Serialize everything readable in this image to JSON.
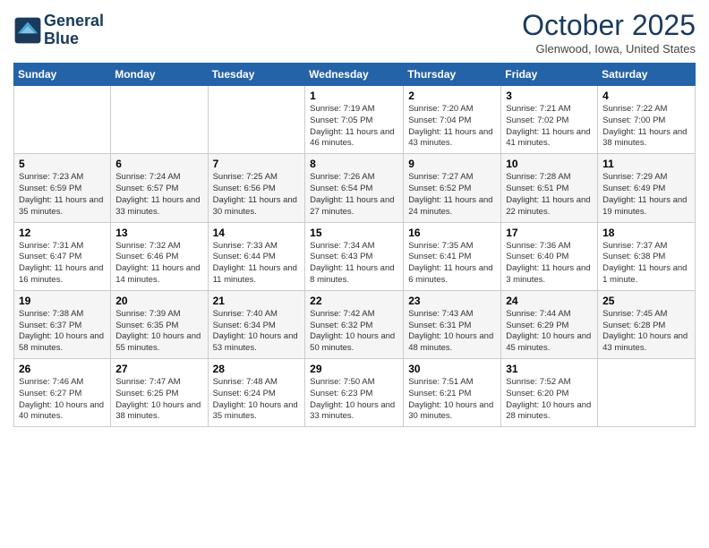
{
  "header": {
    "logo_line1": "General",
    "logo_line2": "Blue",
    "month": "October 2025",
    "location": "Glenwood, Iowa, United States"
  },
  "weekdays": [
    "Sunday",
    "Monday",
    "Tuesday",
    "Wednesday",
    "Thursday",
    "Friday",
    "Saturday"
  ],
  "weeks": [
    [
      {
        "day": "",
        "info": ""
      },
      {
        "day": "",
        "info": ""
      },
      {
        "day": "",
        "info": ""
      },
      {
        "day": "1",
        "info": "Sunrise: 7:19 AM\nSunset: 7:05 PM\nDaylight: 11 hours\nand 46 minutes."
      },
      {
        "day": "2",
        "info": "Sunrise: 7:20 AM\nSunset: 7:04 PM\nDaylight: 11 hours\nand 43 minutes."
      },
      {
        "day": "3",
        "info": "Sunrise: 7:21 AM\nSunset: 7:02 PM\nDaylight: 11 hours\nand 41 minutes."
      },
      {
        "day": "4",
        "info": "Sunrise: 7:22 AM\nSunset: 7:00 PM\nDaylight: 11 hours\nand 38 minutes."
      }
    ],
    [
      {
        "day": "5",
        "info": "Sunrise: 7:23 AM\nSunset: 6:59 PM\nDaylight: 11 hours\nand 35 minutes."
      },
      {
        "day": "6",
        "info": "Sunrise: 7:24 AM\nSunset: 6:57 PM\nDaylight: 11 hours\nand 33 minutes."
      },
      {
        "day": "7",
        "info": "Sunrise: 7:25 AM\nSunset: 6:56 PM\nDaylight: 11 hours\nand 30 minutes."
      },
      {
        "day": "8",
        "info": "Sunrise: 7:26 AM\nSunset: 6:54 PM\nDaylight: 11 hours\nand 27 minutes."
      },
      {
        "day": "9",
        "info": "Sunrise: 7:27 AM\nSunset: 6:52 PM\nDaylight: 11 hours\nand 24 minutes."
      },
      {
        "day": "10",
        "info": "Sunrise: 7:28 AM\nSunset: 6:51 PM\nDaylight: 11 hours\nand 22 minutes."
      },
      {
        "day": "11",
        "info": "Sunrise: 7:29 AM\nSunset: 6:49 PM\nDaylight: 11 hours\nand 19 minutes."
      }
    ],
    [
      {
        "day": "12",
        "info": "Sunrise: 7:31 AM\nSunset: 6:47 PM\nDaylight: 11 hours\nand 16 minutes."
      },
      {
        "day": "13",
        "info": "Sunrise: 7:32 AM\nSunset: 6:46 PM\nDaylight: 11 hours\nand 14 minutes."
      },
      {
        "day": "14",
        "info": "Sunrise: 7:33 AM\nSunset: 6:44 PM\nDaylight: 11 hours\nand 11 minutes."
      },
      {
        "day": "15",
        "info": "Sunrise: 7:34 AM\nSunset: 6:43 PM\nDaylight: 11 hours\nand 8 minutes."
      },
      {
        "day": "16",
        "info": "Sunrise: 7:35 AM\nSunset: 6:41 PM\nDaylight: 11 hours\nand 6 minutes."
      },
      {
        "day": "17",
        "info": "Sunrise: 7:36 AM\nSunset: 6:40 PM\nDaylight: 11 hours\nand 3 minutes."
      },
      {
        "day": "18",
        "info": "Sunrise: 7:37 AM\nSunset: 6:38 PM\nDaylight: 11 hours\nand 1 minute."
      }
    ],
    [
      {
        "day": "19",
        "info": "Sunrise: 7:38 AM\nSunset: 6:37 PM\nDaylight: 10 hours\nand 58 minutes."
      },
      {
        "day": "20",
        "info": "Sunrise: 7:39 AM\nSunset: 6:35 PM\nDaylight: 10 hours\nand 55 minutes."
      },
      {
        "day": "21",
        "info": "Sunrise: 7:40 AM\nSunset: 6:34 PM\nDaylight: 10 hours\nand 53 minutes."
      },
      {
        "day": "22",
        "info": "Sunrise: 7:42 AM\nSunset: 6:32 PM\nDaylight: 10 hours\nand 50 minutes."
      },
      {
        "day": "23",
        "info": "Sunrise: 7:43 AM\nSunset: 6:31 PM\nDaylight: 10 hours\nand 48 minutes."
      },
      {
        "day": "24",
        "info": "Sunrise: 7:44 AM\nSunset: 6:29 PM\nDaylight: 10 hours\nand 45 minutes."
      },
      {
        "day": "25",
        "info": "Sunrise: 7:45 AM\nSunset: 6:28 PM\nDaylight: 10 hours\nand 43 minutes."
      }
    ],
    [
      {
        "day": "26",
        "info": "Sunrise: 7:46 AM\nSunset: 6:27 PM\nDaylight: 10 hours\nand 40 minutes."
      },
      {
        "day": "27",
        "info": "Sunrise: 7:47 AM\nSunset: 6:25 PM\nDaylight: 10 hours\nand 38 minutes."
      },
      {
        "day": "28",
        "info": "Sunrise: 7:48 AM\nSunset: 6:24 PM\nDaylight: 10 hours\nand 35 minutes."
      },
      {
        "day": "29",
        "info": "Sunrise: 7:50 AM\nSunset: 6:23 PM\nDaylight: 10 hours\nand 33 minutes."
      },
      {
        "day": "30",
        "info": "Sunrise: 7:51 AM\nSunset: 6:21 PM\nDaylight: 10 hours\nand 30 minutes."
      },
      {
        "day": "31",
        "info": "Sunrise: 7:52 AM\nSunset: 6:20 PM\nDaylight: 10 hours\nand 28 minutes."
      },
      {
        "day": "",
        "info": ""
      }
    ]
  ]
}
